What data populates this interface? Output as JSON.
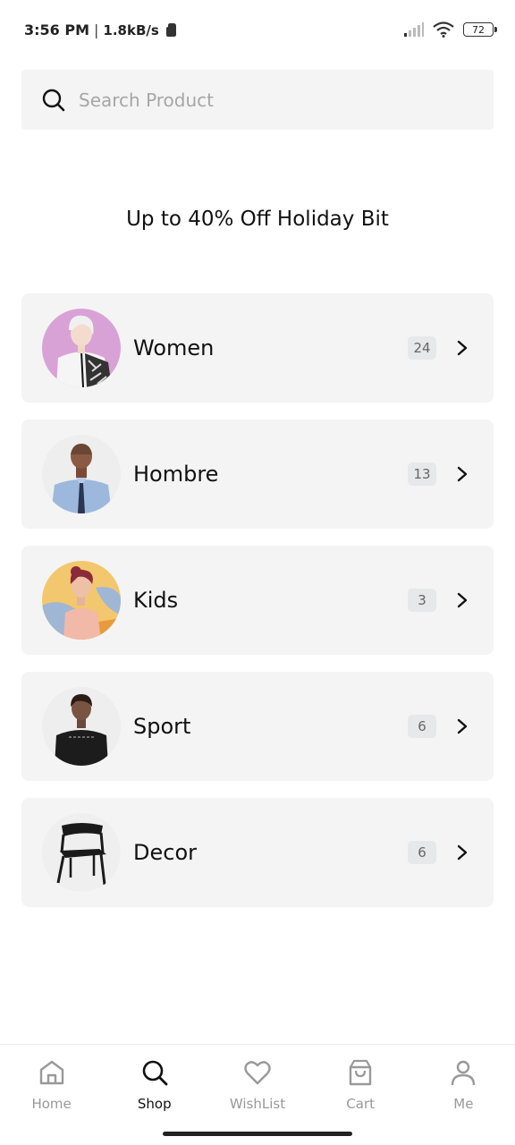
{
  "status_bar": {
    "time": "3:56 PM",
    "separator": "|",
    "net_speed": "1.8kB/s",
    "battery": "72"
  },
  "search": {
    "placeholder": "Search Product",
    "icon": "search-icon"
  },
  "promo": {
    "text": "Up to 40% Off Holiday Bit"
  },
  "categories": [
    {
      "name": "Women",
      "count": "24",
      "image": "woman-fashion-photo"
    },
    {
      "name": "Hombre",
      "count": "13",
      "image": "man-shirt-tie-photo"
    },
    {
      "name": "Kids",
      "count": "3",
      "image": "girl-pink-top-photo"
    },
    {
      "name": "Sport",
      "count": "6",
      "image": "woman-black-tee-photo"
    },
    {
      "name": "Decor",
      "count": "6",
      "image": "black-chair-photo"
    }
  ],
  "bottom_nav": {
    "items": [
      {
        "label": "Home",
        "icon": "home-icon",
        "active": false
      },
      {
        "label": "Shop",
        "icon": "search-icon",
        "active": true
      },
      {
        "label": "WishList",
        "icon": "heart-icon",
        "active": false
      },
      {
        "label": "Cart",
        "icon": "shopping-bag-icon",
        "active": false
      },
      {
        "label": "Me",
        "icon": "user-icon",
        "active": false
      }
    ]
  },
  "colors": {
    "card_bg": "#f4f4f4",
    "badge_bg": "#e6e8ea",
    "nav_inactive": "#999999",
    "nav_active": "#111111"
  }
}
